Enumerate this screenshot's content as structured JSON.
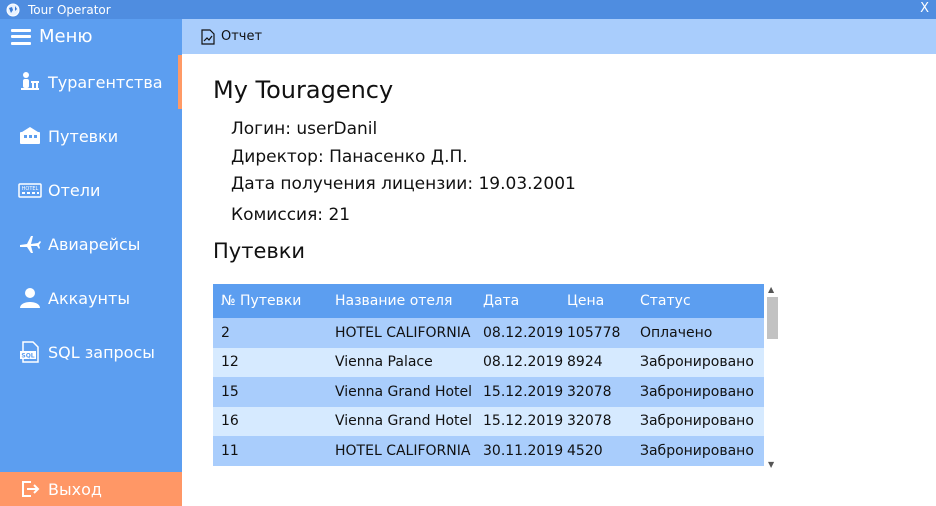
{
  "window": {
    "title": "Tour Operator",
    "close_label": "X"
  },
  "sidebar": {
    "menu_label": "Меню",
    "items": [
      {
        "label": "Турагентства",
        "icon": "agency-icon"
      },
      {
        "label": "Путевки",
        "icon": "tours-icon"
      },
      {
        "label": "Отели",
        "icon": "hotel-icon"
      },
      {
        "label": "Авиарейсы",
        "icon": "airplane-icon"
      },
      {
        "label": "Аккаунты",
        "icon": "user-icon"
      },
      {
        "label": "SQL запросы",
        "icon": "sql-icon"
      }
    ],
    "logout_label": "Выход"
  },
  "toolbar": {
    "report_label": "Отчет"
  },
  "agency": {
    "name": "My Touragency",
    "login": "Логин: userDanil",
    "director": "Директор: Панасенко Д.П.",
    "license_date": "Дата получения лицензии: 19.03.2001",
    "commission": "Комиссия: 21"
  },
  "tours": {
    "title": "Путевки",
    "columns": [
      "№ Путевки",
      "Название отеля",
      "Дата",
      "Цена",
      "Статус"
    ],
    "rows": [
      [
        "2",
        "HOTEL CALIFORNIA",
        "08.12.2019",
        "105778",
        "Оплачено"
      ],
      [
        "12",
        "Vienna Palace",
        "08.12.2019",
        "8924",
        "Забронировано"
      ],
      [
        "15",
        "Vienna Grand Hotel",
        "15.12.2019",
        "32078",
        "Забронировано"
      ],
      [
        "16",
        "Vienna Grand Hotel",
        "15.12.2019",
        "32078",
        "Забронировано"
      ],
      [
        "11",
        "HOTEL CALIFORNIA",
        "30.11.2019",
        "4520",
        "Забронировано"
      ]
    ]
  },
  "colors": {
    "sidebar": "#5c9ef0",
    "toolbar": "#a9cdfc",
    "accent": "#ff9766",
    "row_light": "#d6eaff"
  }
}
